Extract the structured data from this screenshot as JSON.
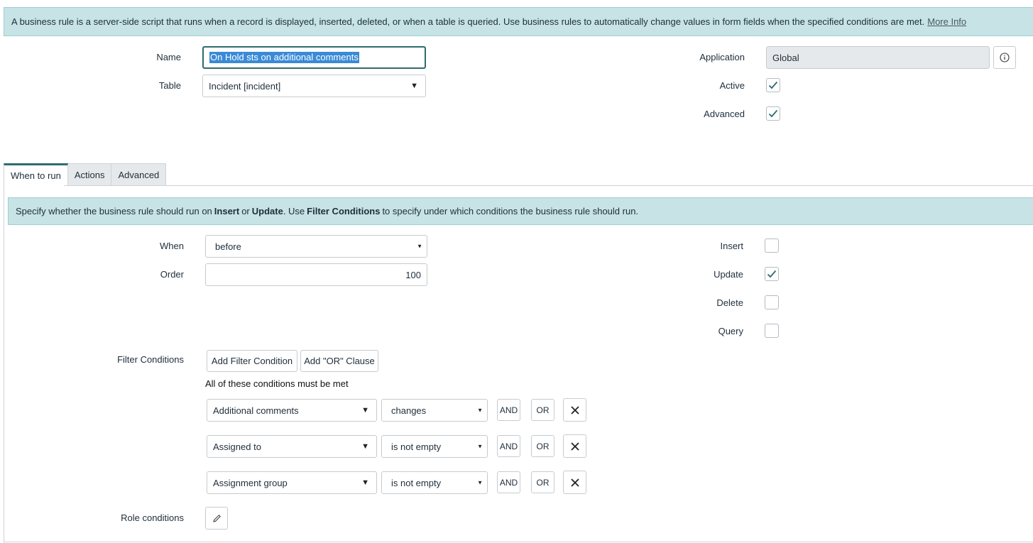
{
  "banner": {
    "text": "A business rule is a server-side script that runs when a record is displayed, inserted, deleted, or when a table is queried. Use business rules to automatically change values in form fields when the specified conditions are met.",
    "link": "More Info"
  },
  "form": {
    "name_label": "Name",
    "name_value": "On Hold sts on additional comments",
    "table_label": "Table",
    "table_value": "Incident [incident]",
    "application_label": "Application",
    "application_value": "Global",
    "active_label": "Active",
    "active_checked": true,
    "advanced_label": "Advanced",
    "advanced_checked": true
  },
  "tabs": [
    {
      "label": "When to run",
      "active": true
    },
    {
      "label": "Actions",
      "active": false
    },
    {
      "label": "Advanced",
      "active": false
    }
  ],
  "info2": {
    "p1": "Specify whether the business rule should run on",
    "insert": "Insert",
    "or": "or",
    "update": "Update",
    "p2": ". Use",
    "filter": "Filter Conditions",
    "p3": "to specify under which conditions the business rule should run."
  },
  "when_to_run": {
    "when_label": "When",
    "when_value": "before",
    "order_label": "Order",
    "order_value": "100",
    "insert_label": "Insert",
    "insert_checked": false,
    "update_label": "Update",
    "update_checked": true,
    "delete_label": "Delete",
    "delete_checked": false,
    "query_label": "Query",
    "query_checked": false
  },
  "filter": {
    "label": "Filter Conditions",
    "add_condition": "Add Filter Condition",
    "add_or": "Add \"OR\" Clause",
    "all_met": "All of these conditions must be met",
    "and_label": "AND",
    "or_label": "OR",
    "conditions": [
      {
        "field": "Additional comments",
        "operator": "changes"
      },
      {
        "field": "Assigned to",
        "operator": "is not empty"
      },
      {
        "field": "Assignment group",
        "operator": "is not empty"
      }
    ]
  },
  "role": {
    "label": "Role conditions"
  },
  "colors": {
    "accent": "#2e6b70",
    "banner_bg": "#c7e3e5",
    "check": "#2e6b70"
  }
}
